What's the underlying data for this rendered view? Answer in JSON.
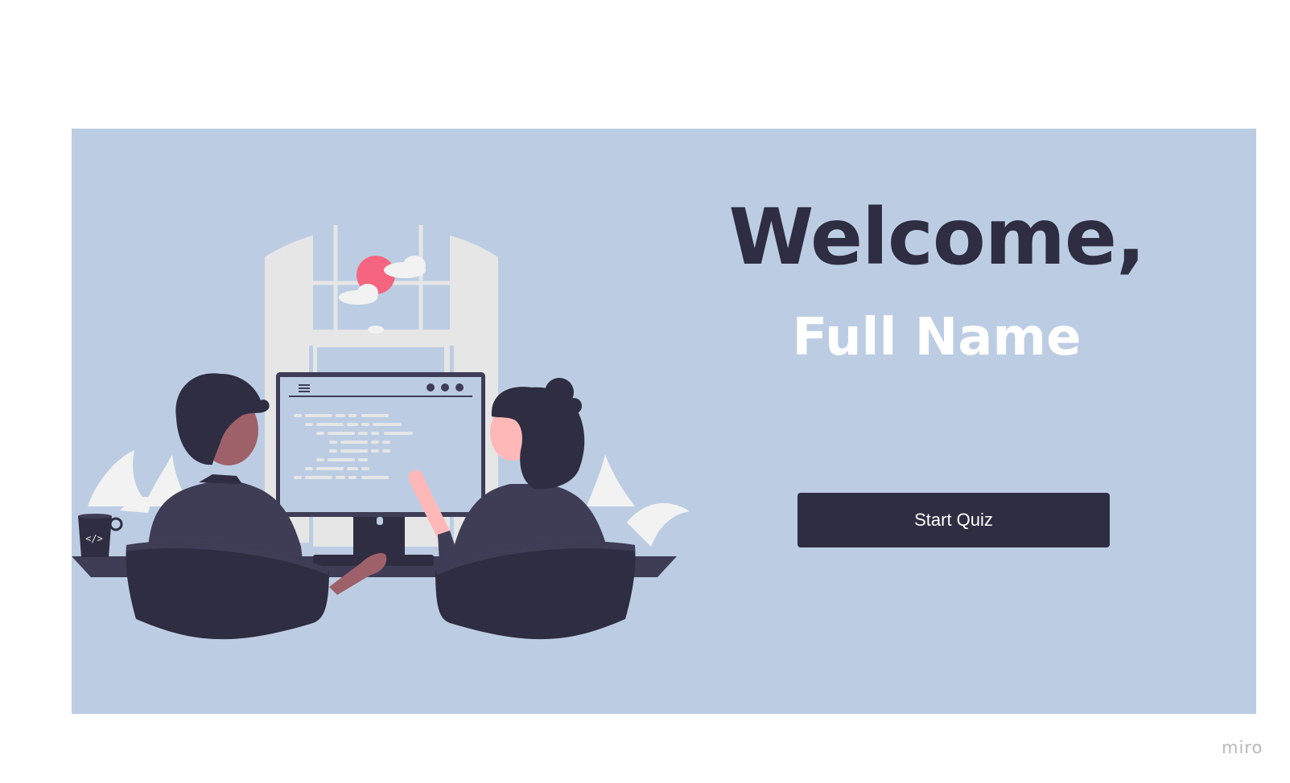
{
  "welcome_card": {
    "heading": "Welcome,",
    "name": "Full Name",
    "start_button_label": "Start Quiz",
    "background_color": "#bccde3",
    "accent_color": "#2f2d41"
  },
  "illustration": {
    "mug_code_symbol": "</>",
    "icons": [
      "two-developers-at-computer-illustration",
      "coffee-mug-icon",
      "menu-icon",
      "window-dots-icon",
      "sun-icon",
      "cloud-icon"
    ]
  },
  "footer": {
    "brand": "miro"
  }
}
